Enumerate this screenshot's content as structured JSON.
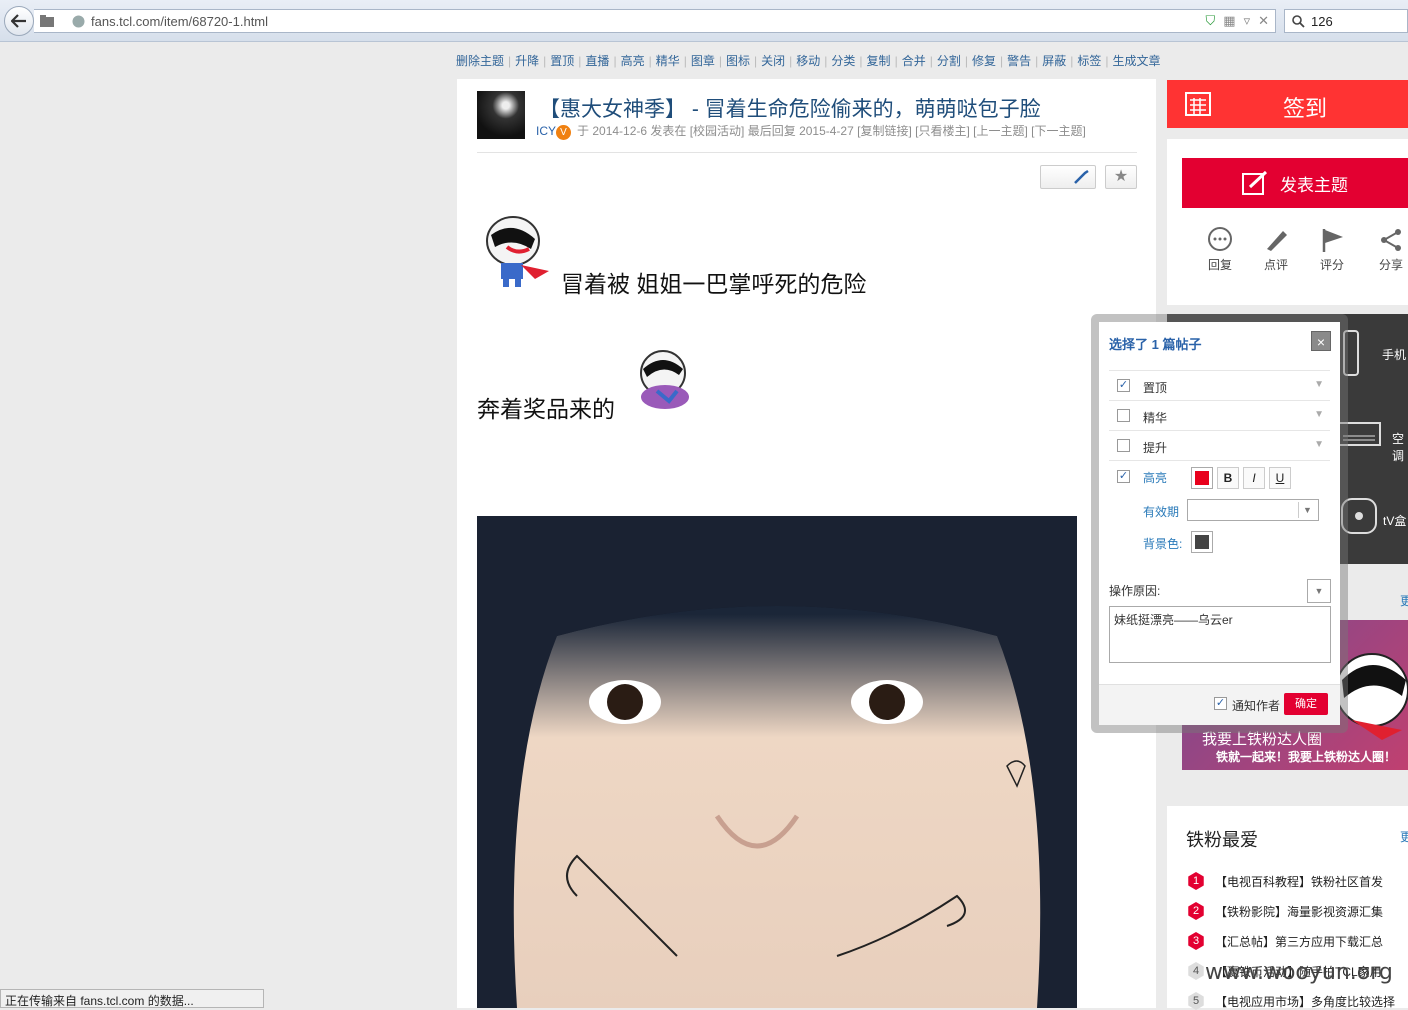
{
  "browser": {
    "url": "fans.tcl.com/item/68720-1.html",
    "search_query": "126",
    "status_text": "正在传输来自 fans.tcl.com 的数据..."
  },
  "mod_toolbar": [
    "删除主题",
    "升降",
    "置顶",
    "直播",
    "高亮",
    "精华",
    "图章",
    "图标",
    "关闭",
    "移动",
    "分类",
    "复制",
    "合并",
    "分割",
    "修复",
    "警告",
    "屏蔽",
    "标签",
    "生成文章"
  ],
  "post": {
    "title": "【惠大女神季】 - 冒着生命危险偷来的，萌萌哒包子脸",
    "author": "ICY",
    "meta": "于 2014-12-6 发表在 [校园活动] 最后回复 2015-4-27 [复制链接] [只看楼主] [上一主题] [下一主题]",
    "line1": "冒着被 姐姐一巴掌呼死的危险",
    "line2": "奔着奖品来的"
  },
  "sidebar": {
    "sign_label": "签到",
    "post_label": "发表主题",
    "actions": [
      "回复",
      "点评",
      "评分",
      "分享"
    ],
    "dark_items": [
      "手机",
      "空调",
      "tV盒"
    ],
    "promo_line1": "我要上铁粉达人圈",
    "promo_line2": "铁就一起来！我要上铁粉达人圈！",
    "fav_title": "铁粉最爱",
    "more_label": "更",
    "fav_items": [
      {
        "n": "1",
        "text": "【电视百科教程】铁粉社区首发"
      },
      {
        "n": "2",
        "text": "【铁粉影院】海量影视资源汇集"
      },
      {
        "n": "3",
        "text": "【汇总帖】第三方应用下载汇总"
      },
      {
        "n": "4",
        "text": "【赢铁币活动】随手拍TCL家用"
      },
      {
        "n": "5",
        "text": "【电视应用市场】多角度比较选择"
      }
    ]
  },
  "dialog": {
    "title": "选择了 1 篇帖子",
    "close": "×",
    "options": [
      {
        "label": "置顶",
        "checked": "✓"
      },
      {
        "label": "精华",
        "checked": ""
      },
      {
        "label": "提升",
        "checked": ""
      }
    ],
    "highlight_label": "高亮",
    "highlight_checked": "✓",
    "bold": "B",
    "italic": "I",
    "underline": "U",
    "expiry_label": "有效期",
    "bg_label": "背景色:",
    "reason_label": "操作原因:",
    "reason_text": "妹纸挺漂亮——乌云er",
    "notify_label": "通知作者",
    "notify_checked": "✓",
    "confirm_label": "确定",
    "highlight_color": "#e8001c"
  },
  "watermark": "www.wooyun.org"
}
